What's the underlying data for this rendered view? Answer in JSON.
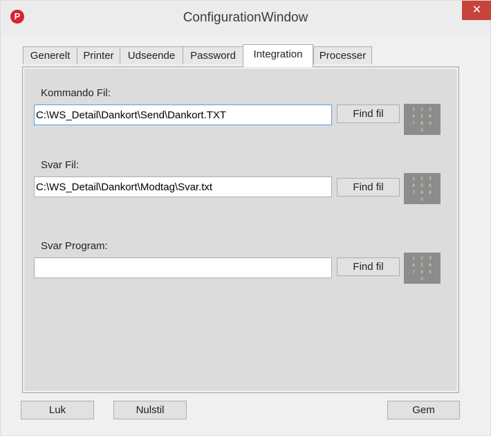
{
  "window": {
    "title": "ConfigurationWindow",
    "app_icon_letter": "P",
    "close_glyph": "✕",
    "colors": {
      "close_bg": "#c7443d",
      "app_icon_bg": "#d9232e",
      "panel_bg": "#dcdcdc",
      "focus_border": "#569de5"
    }
  },
  "tabs": [
    {
      "label": "Generelt"
    },
    {
      "label": "Printer"
    },
    {
      "label": "Udseende"
    },
    {
      "label": "Password"
    },
    {
      "label": "Integration",
      "active": true
    },
    {
      "label": "Processer"
    }
  ],
  "fields": [
    {
      "label": "Kommando Fil:",
      "value": "C:\\WS_Detail\\Dankort\\Send\\Dankort.TXT",
      "button": "Find fil",
      "icon": "numeric-keypad-icon"
    },
    {
      "label": "Svar Fil:",
      "value": "C:\\WS_Detail\\Dankort\\Modtag\\Svar.txt",
      "button": "Find fil",
      "icon": "numeric-keypad-icon"
    },
    {
      "label": "Svar Program:",
      "value": "",
      "button": "Find fil",
      "icon": "numeric-keypad-icon"
    }
  ],
  "footer": {
    "close_label": "Luk",
    "reset_label": "Nulstil",
    "save_label": "Gem"
  }
}
